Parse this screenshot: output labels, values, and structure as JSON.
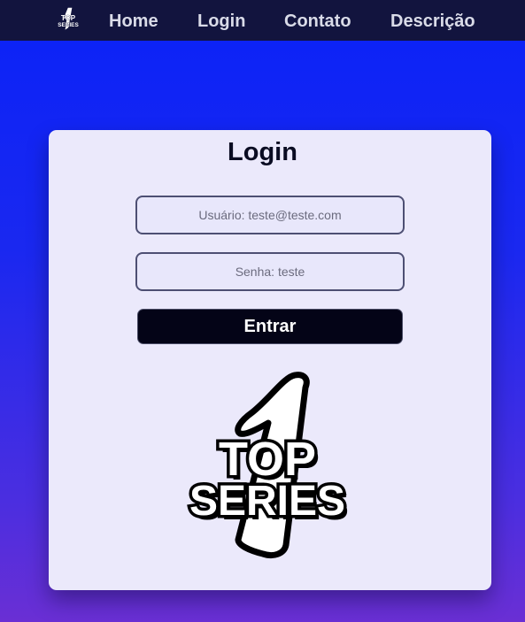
{
  "nav": {
    "logo": {
      "icon": "top-series-logo-icon",
      "text_top": "TOP",
      "text_bottom": "SERIES",
      "numeral": "1"
    },
    "items": [
      {
        "label": "Home"
      },
      {
        "label": "Login"
      },
      {
        "label": "Contato"
      },
      {
        "label": "Descrição"
      }
    ]
  },
  "login": {
    "title": "Login",
    "username_placeholder": "Usuário: teste@teste.com",
    "username_value": "",
    "password_placeholder": "Senha: teste",
    "password_value": "",
    "submit_label": "Entrar"
  },
  "brand": {
    "icon": "top-series-logo-icon",
    "text_top": "TOP",
    "text_bottom": "SERIES",
    "numeral": "1"
  },
  "colors": {
    "navbar": "#12143e",
    "background_top": "#0a22f8",
    "background_bottom": "#6a2fd4",
    "card": "#ebe9fb",
    "button": "#040417",
    "nav_text": "#d9dbe8"
  }
}
